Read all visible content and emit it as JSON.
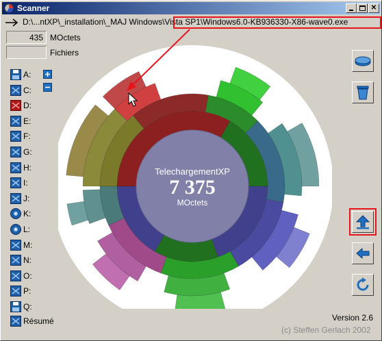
{
  "window": {
    "title": "Scanner"
  },
  "path": {
    "text": "D:\\...ntXP\\_installation\\_MAJ Windows\\Vista SP1\\Windows6.0-KB936330-X86-wave0.exe"
  },
  "stats": {
    "size_value": "435",
    "size_label": "MOctets",
    "files_value": "",
    "files_label": "Fichiers"
  },
  "drives": [
    {
      "label": "A:",
      "icon": "floppy-icon"
    },
    {
      "label": "C:",
      "icon": "hard-drive-icon"
    },
    {
      "label": "D:",
      "icon": "hard-drive-red-icon"
    },
    {
      "label": "E:",
      "icon": "hard-drive-icon"
    },
    {
      "label": "F:",
      "icon": "hard-drive-icon"
    },
    {
      "label": "G:",
      "icon": "hard-drive-icon"
    },
    {
      "label": "H:",
      "icon": "hard-drive-icon"
    },
    {
      "label": "I:",
      "icon": "hard-drive-icon"
    },
    {
      "label": "J:",
      "icon": "hard-drive-icon"
    },
    {
      "label": "K:",
      "icon": "cd-icon"
    },
    {
      "label": "L:",
      "icon": "cd-icon"
    },
    {
      "label": "M:",
      "icon": "hard-drive-icon"
    },
    {
      "label": "N:",
      "icon": "hard-drive-icon"
    },
    {
      "label": "O:",
      "icon": "hard-drive-icon"
    },
    {
      "label": "P:",
      "icon": "hard-drive-icon"
    },
    {
      "label": "Q:",
      "icon": "floppy-icon"
    }
  ],
  "summary": {
    "label": "Résumé"
  },
  "center": {
    "name": "TelechargementXP",
    "value": "7 375",
    "unit": "MOctets"
  },
  "footer": {
    "version": "Version 2.6",
    "copyright": "(c) Steffen Gerlach 2002"
  },
  "colors": {
    "accent_highlight": "#e8141c",
    "center_fill": "#8080a8",
    "ring1_blue": "#40408c",
    "ring1_red": "#8c2020",
    "ring1_green": "#207020"
  }
}
